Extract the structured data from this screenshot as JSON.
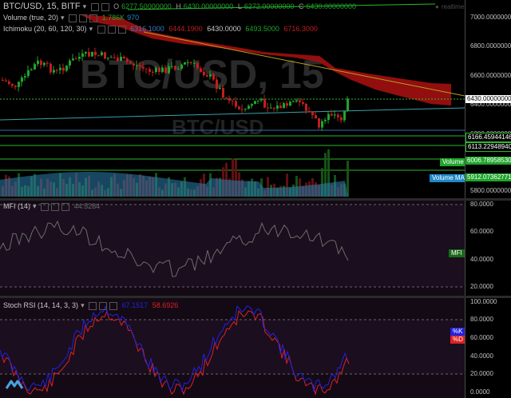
{
  "header": {
    "symbol": "BTC/USD, 15, BITF",
    "open_label": "O",
    "open": "6277.50000000",
    "high_label": "H",
    "high": "6430.00000000",
    "low_label": "L",
    "low": "6272.00000000",
    "close_label": "C",
    "close": "6430.00000000",
    "realtime": "realtime"
  },
  "indicators": {
    "volume": {
      "name": "Volume (true, 20)",
      "v1": "1.786K",
      "v2": "970"
    },
    "ichimoku": {
      "name": "Ichimoku (20, 60, 120, 30)",
      "v1": "6316.1000",
      "v2": "6444.1900",
      "v3": "6430.0000",
      "v4": "6493.5000",
      "v5": "6716.3000"
    },
    "mfi": {
      "name": "MFI (14)",
      "value": "44.5284"
    },
    "stoch": {
      "name": "Stoch RSI (14, 14, 3, 3)",
      "k": "67.1517",
      "d": "58.6926"
    }
  },
  "watermark": {
    "big": "BTC/USD, 15",
    "small": "BTC/USD"
  },
  "price_axis": {
    "ticks": [
      "7000.00000000",
      "6800.00000000",
      "6600.00000000",
      "6400.00000000",
      "6200.00000000",
      "6000.00000000",
      "5800.00000000"
    ],
    "labels": {
      "last": "6430.00000000",
      "lvl1": "6166.45944146",
      "lvl2": "6113.22948940",
      "lvl3": "6006.78958530",
      "lvl4": "5912.07362771"
    },
    "volume_tag": "Volume",
    "volume_ma_tag": "Volume MA"
  },
  "mfi_axis": {
    "ticks": [
      "80.0000",
      "60.0000",
      "40.0000",
      "20.0000"
    ],
    "tag": "MFI"
  },
  "stoch_axis": {
    "ticks": [
      "100.0000",
      "80.0000",
      "60.0000",
      "40.0000",
      "20.0000",
      "0.0000"
    ],
    "k_tag": "%K",
    "d_tag": "%D"
  },
  "colors": {
    "up": "#1fa52b",
    "down": "#c21e1e",
    "cloud": "#9b0f0f",
    "mfi_line": "#6c6c6c",
    "k_line": "#2222dd",
    "d_line": "#dd2222",
    "teal": "#3aa0a8",
    "green_line": "#2db82d",
    "mfi_bg": "#1a0e1c",
    "stoch_bg": "#1a0e1c",
    "tag_blue": "#1e88c8"
  }
}
